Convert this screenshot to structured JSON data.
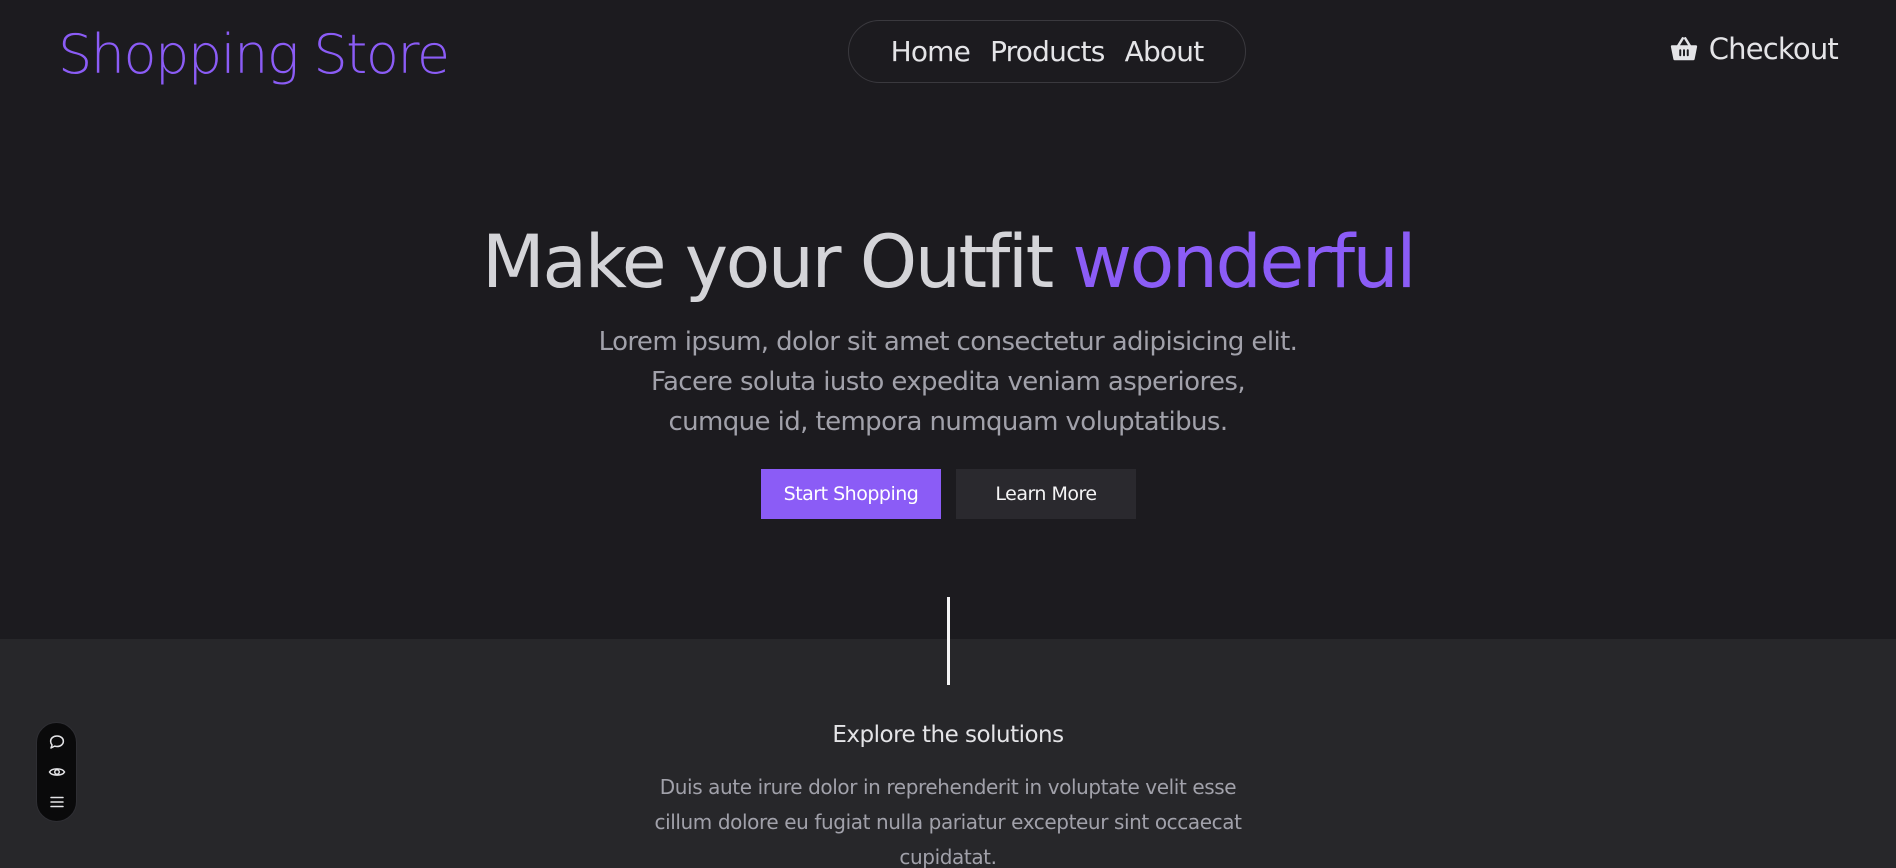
{
  "header": {
    "logo": "Shopping Store",
    "nav": [
      {
        "label": "Home"
      },
      {
        "label": "Products"
      },
      {
        "label": "About"
      }
    ],
    "checkout_label": "Checkout",
    "checkout_icon": "basket-icon"
  },
  "hero": {
    "title_main": "Make your Outfit ",
    "title_accent": "wonderful",
    "subtitle": "Lorem ipsum, dolor sit amet consectetur adipisicing elit. Facere soluta iusto expedita veniam asperiores, cumque id, tempora numquam voluptatibus.",
    "primary_button": "Start Shopping",
    "secondary_button": "Learn More"
  },
  "solutions": {
    "title": "Explore the solutions",
    "text": "Duis aute irure dolor in reprehenderit in voluptate velit esse cillum dolore eu fugiat nulla pariatur excepteur sint occaecat cupidatat."
  },
  "toolbar": {
    "icons": [
      "chat-bubble-icon",
      "eye-icon",
      "menu-icon"
    ]
  },
  "colors": {
    "background": "#1c1b1f",
    "section_background": "#27272a",
    "accent": "#8b5cf6",
    "text_primary": "#d4d4d8",
    "text_muted": "#a1a1aa",
    "secondary_button": "#2a292e"
  }
}
